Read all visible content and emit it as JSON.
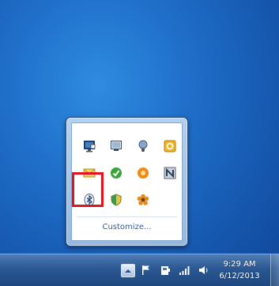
{
  "flyout": {
    "customize_label": "Customize...",
    "icons": [
      {
        "name": "action-center-icon"
      },
      {
        "name": "display-icon"
      },
      {
        "name": "bulb-icon"
      },
      {
        "name": "notes-icon"
      },
      {
        "name": "mail-icon"
      },
      {
        "name": "update-icon"
      },
      {
        "name": "orange-circle-icon"
      },
      {
        "name": "network-monitor-icon"
      },
      {
        "name": "bluetooth-icon"
      },
      {
        "name": "security-shield-icon"
      },
      {
        "name": "flower-icon"
      }
    ]
  },
  "taskbar": {
    "time": "9:29 AM",
    "date": "6/12/2013"
  },
  "colors": {
    "highlight": "#e0121e",
    "link": "#2a5fa8"
  }
}
